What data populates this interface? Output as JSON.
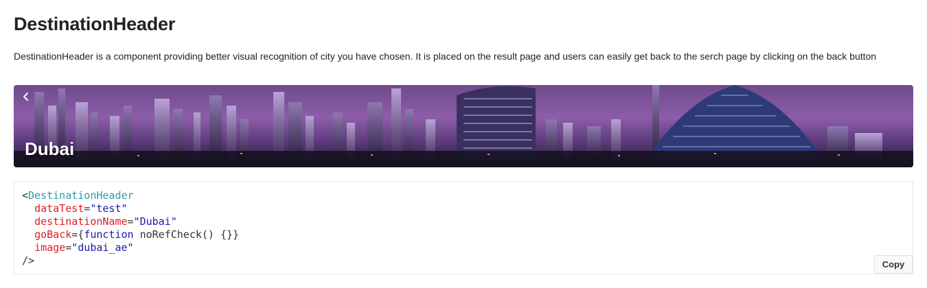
{
  "page": {
    "title": "DestinationHeader",
    "description": "DestinationHeader is a component providing better visual recognition of city you have chosen. It is placed on the result page and users can easily get back to the serch page by clicking on the back button"
  },
  "hero": {
    "city_name": "Dubai",
    "back_icon": "chevron-left-icon",
    "colors": {
      "sky_top": "#6f4a8c",
      "sky_mid": "#8d5da9",
      "ground": "#1c1426"
    }
  },
  "code": {
    "open_tag": "<",
    "component": "DestinationHeader",
    "props": [
      {
        "name": "dataTest",
        "eq": "=",
        "value": "\"test\""
      },
      {
        "name": "destinationName",
        "eq": "=",
        "value": "\"Dubai\""
      },
      {
        "name": "goBack",
        "eq": "={",
        "value": "function",
        "rest": " noRefCheck() {}}"
      },
      {
        "name": "image",
        "eq": "=",
        "value": "\"dubai_ae\""
      }
    ],
    "close_tag": "/>",
    "copy_label": "Copy"
  }
}
